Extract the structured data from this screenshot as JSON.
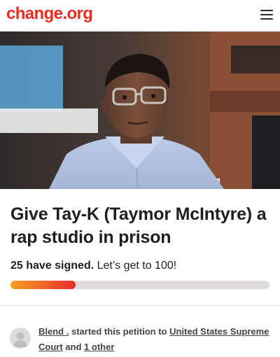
{
  "header": {
    "logo_text": "change.org",
    "menu_icon": "hamburger-menu-icon",
    "brand_color": "#ec2c22"
  },
  "hero": {
    "image_subject": "young man with glasses in light blue shirt in a courtroom"
  },
  "petition": {
    "title": "Give Tay-K (Taymor McIntyre) a rap studio in prison",
    "signed_count": "25 have signed.",
    "goal_text": "Let’s get to 100!",
    "progress_fraction": 0.25
  },
  "starter": {
    "avatar_icon": "default-user-avatar-icon",
    "name": "Blend .",
    "started_text": "started this petition to",
    "target": "United States Supreme Court",
    "and_text": "and",
    "other": "1 other"
  }
}
